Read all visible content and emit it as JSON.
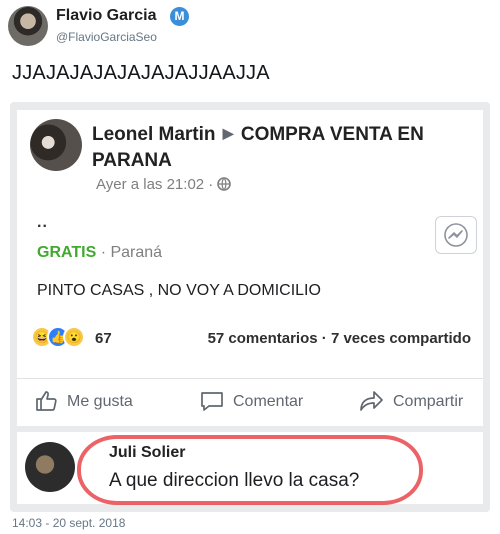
{
  "tweet": {
    "author_name": "Flavio Garcia",
    "verified_badge": "M",
    "handle": "@FlavioGarciaSeo",
    "text": "JJAJAJAJAJAJAJAJJAAJJA",
    "timestamp": "14:03 - 20 sept. 2018"
  },
  "fb_post": {
    "author": "Leonel Martin",
    "group": "COMPRA VENTA EN PARANA",
    "time": "Ayer a las 21:02 · ",
    "dots": "..",
    "price": "GRATIS",
    "location": " · Paraná",
    "body": "PINTO CASAS , NO VOY A DOMICILIO",
    "reaction_count": "67",
    "stats": "57 comentarios · 7 veces compartido",
    "actions": {
      "like": "Me gusta",
      "comment": "Comentar",
      "share": "Compartir"
    }
  },
  "comment": {
    "author": "Juli Solier",
    "text": "A que direccion llevo la casa?"
  },
  "icons": [
    "verified-icon",
    "globe-icon",
    "messenger-icon",
    "like-icon",
    "comment-icon",
    "share-icon"
  ],
  "colors": {
    "price_green": "#42a92f",
    "highlight_red": "#e8484b",
    "tw_grey": "#657786"
  }
}
